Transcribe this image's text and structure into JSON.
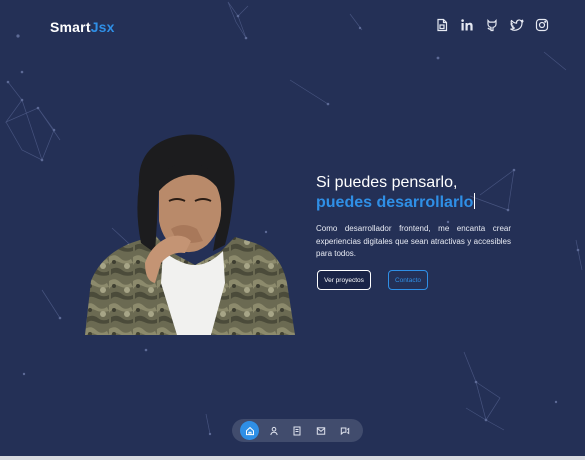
{
  "app": {
    "logo_main": "Smart",
    "logo_accent": "Jsx"
  },
  "header": {
    "social_icons": [
      "document-icon",
      "linkedin-icon",
      "github-icon",
      "twitter-icon",
      "instagram-icon"
    ]
  },
  "hero": {
    "title_line1": "Si puedes pensarlo,",
    "title_line2": "puedes desarrollarlo",
    "description": "Como desarrollador frontend, me encanta crear experiencias digitales que sean atractivas y accesibles para todos.",
    "primary_button": "Ver proyectos",
    "secondary_button": "Contacto"
  },
  "dock": {
    "items": [
      "home-icon",
      "user-icon",
      "book-icon",
      "mail-icon",
      "message-icon"
    ],
    "active_item": "home-icon"
  },
  "colors": {
    "background": "#243056",
    "accent": "#2f8fe6",
    "dock": "#414c6d"
  }
}
